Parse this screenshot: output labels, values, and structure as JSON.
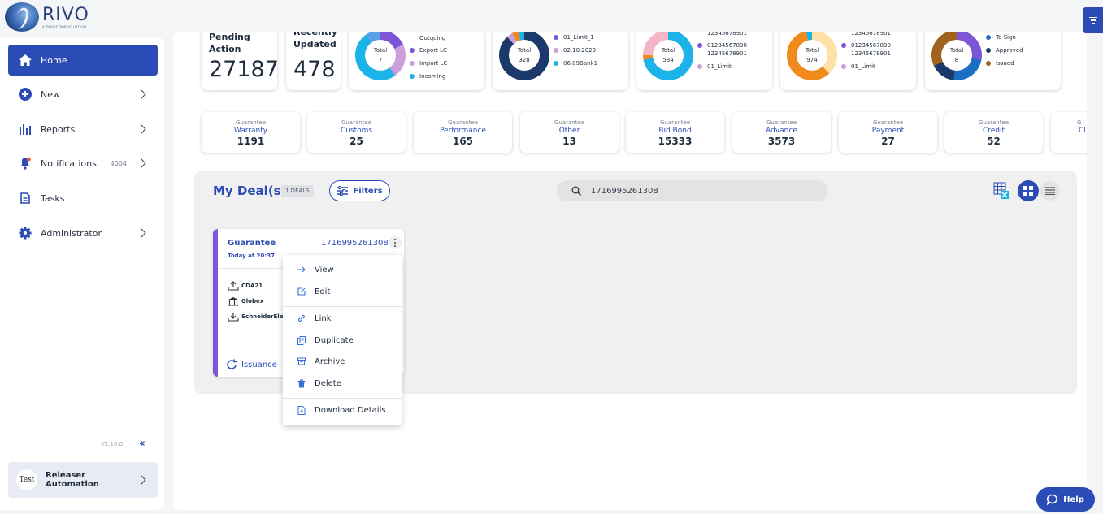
{
  "brand": {
    "name": "RIVO",
    "tagline": "A DUSKCOMP SOLUTION"
  },
  "colors": {
    "primary": "#2b4cb6",
    "accent_purple": "#7c56d6",
    "cyan": "#1bb3e8",
    "navy": "#1b3a6b",
    "orange": "#f08a1c"
  },
  "sidebar": {
    "items": [
      {
        "label": "Home",
        "icon": "home-icon",
        "active": true
      },
      {
        "label": "New",
        "icon": "plus-circle-icon"
      },
      {
        "label": "Reports",
        "icon": "bar-chart-icon"
      },
      {
        "label": "Notifications",
        "icon": "bell-icon",
        "count": "4004"
      },
      {
        "label": "Tasks",
        "icon": "document-icon"
      },
      {
        "label": "Administrator",
        "icon": "gear-icon"
      }
    ],
    "version": "V2.10.0",
    "user": {
      "avatar_text": "Test",
      "name": "Releaser Automation"
    }
  },
  "stats": [
    {
      "title": "Pending Action",
      "value": "27187"
    },
    {
      "title": "Recently Updated",
      "value": "478"
    }
  ],
  "donuts": [
    {
      "total_label": "Total",
      "total": "7",
      "legend": [
        {
          "label": "Outgoing",
          "color": ""
        },
        {
          "label": "Export LC",
          "color": "#7c56d6"
        },
        {
          "label": "Import LC",
          "color": "#c9a0dc"
        },
        {
          "label": "Incoming",
          "color": "#1bb3e8"
        }
      ]
    },
    {
      "total_label": "Total",
      "total": "328",
      "legend": [
        {
          "label": "01_Limit_1",
          "color": "#7c56d6"
        },
        {
          "label": "02.10.2023",
          "color": "#c9a0dc"
        },
        {
          "label": "06.09Bank1",
          "color": "#1bb3e8"
        }
      ]
    },
    {
      "total_label": "Total",
      "total": "534",
      "legend": [
        {
          "label": "12345678901",
          "color": ""
        },
        {
          "label": "01234567890",
          "color": "#7c56d6"
        },
        {
          "label": "12345678901",
          "color": ""
        },
        {
          "label": "01_Limit",
          "color": "#c9a0dc"
        }
      ]
    },
    {
      "total_label": "Total",
      "total": "974",
      "legend": [
        {
          "label": "12345678901",
          "color": ""
        },
        {
          "label": "01234567890",
          "color": "#7c56d6"
        },
        {
          "label": "12345678901",
          "color": ""
        },
        {
          "label": "01_Limit",
          "color": "#c9a0dc"
        }
      ]
    },
    {
      "total_label": "Total",
      "total": "8",
      "legend": [
        {
          "label": "To Sign",
          "color": "#1b6fc2"
        },
        {
          "label": "Approved",
          "color": "#1b3a6b"
        },
        {
          "label": "Issued",
          "color": "#a0621c"
        }
      ]
    }
  ],
  "guarantees": [
    {
      "kind": "Guarantee",
      "name": "Warranty",
      "value": "1191"
    },
    {
      "kind": "Guarantee",
      "name": "Customs",
      "value": "25"
    },
    {
      "kind": "Guarantee",
      "name": "Performance",
      "value": "165"
    },
    {
      "kind": "Guarantee",
      "name": "Other",
      "value": "13"
    },
    {
      "kind": "Guarantee",
      "name": "Bid Bond",
      "value": "15333"
    },
    {
      "kind": "Guarantee",
      "name": "Advance",
      "value": "3573"
    },
    {
      "kind": "Guarantee",
      "name": "Payment",
      "value": "27"
    },
    {
      "kind": "Guarantee",
      "name": "Credit",
      "value": "52"
    },
    {
      "kind": "G",
      "name": "Cl",
      "value": ""
    }
  ],
  "deals": {
    "title": "My Deal(s)",
    "count_badge": "1 DEALS",
    "filters_label": "Filters",
    "search_value": "1716995261308",
    "card": {
      "type": "Guarantee",
      "id": "1716995261308",
      "date": "Today at 20:37",
      "parties": [
        "CDA21",
        "Globex",
        "SchneiderEle"
      ],
      "status": "Issuance –"
    }
  },
  "context_menu": {
    "items": [
      {
        "label": "View",
        "icon": "arrow-right-icon"
      },
      {
        "label": "Edit",
        "icon": "edit-icon"
      },
      {
        "label": "Link",
        "icon": "link-icon"
      },
      {
        "label": "Duplicate",
        "icon": "duplicate-icon"
      },
      {
        "label": "Archive",
        "icon": "archive-icon"
      },
      {
        "label": "Delete",
        "icon": "trash-icon"
      },
      {
        "label": "Download Details",
        "icon": "download-doc-icon"
      }
    ]
  },
  "help_label": "Help"
}
